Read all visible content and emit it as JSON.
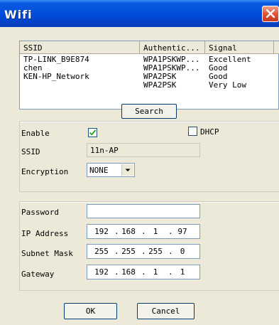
{
  "window": {
    "title": "Wifi"
  },
  "list": {
    "columns": [
      "SSID",
      "Authentic...",
      "Signal"
    ],
    "rows": [
      {
        "ssid": "TP-LINK_B9E874",
        "auth": "WPA1PSKWP...",
        "signal": "Excellent"
      },
      {
        "ssid": "chen",
        "auth": "WPA1PSKWP...",
        "signal": "Good"
      },
      {
        "ssid": "KEN-HP_Network",
        "auth": "WPA2PSK",
        "signal": "Good"
      },
      {
        "ssid": "",
        "auth": "WPA2PSK",
        "signal": "Very Low"
      }
    ]
  },
  "buttons": {
    "search": "Search",
    "ok": "OK",
    "cancel": "Cancel"
  },
  "form": {
    "enable_label": "Enable",
    "enable_checked": true,
    "dhcp_label": "DHCP",
    "dhcp_checked": false,
    "ssid_label": "SSID",
    "ssid_value": "11n-AP",
    "encryption_label": "Encryption",
    "encryption_value": "NONE",
    "password_label": "Password",
    "password_value": "",
    "ip_label": "IP Address",
    "ip": [
      "192",
      "168",
      "1",
      "97"
    ],
    "mask_label": "Subnet Mask",
    "mask": [
      "255",
      "255",
      "255",
      "0"
    ],
    "gateway_label": "Gateway",
    "gateway": [
      "192",
      "168",
      "1",
      "1"
    ]
  }
}
